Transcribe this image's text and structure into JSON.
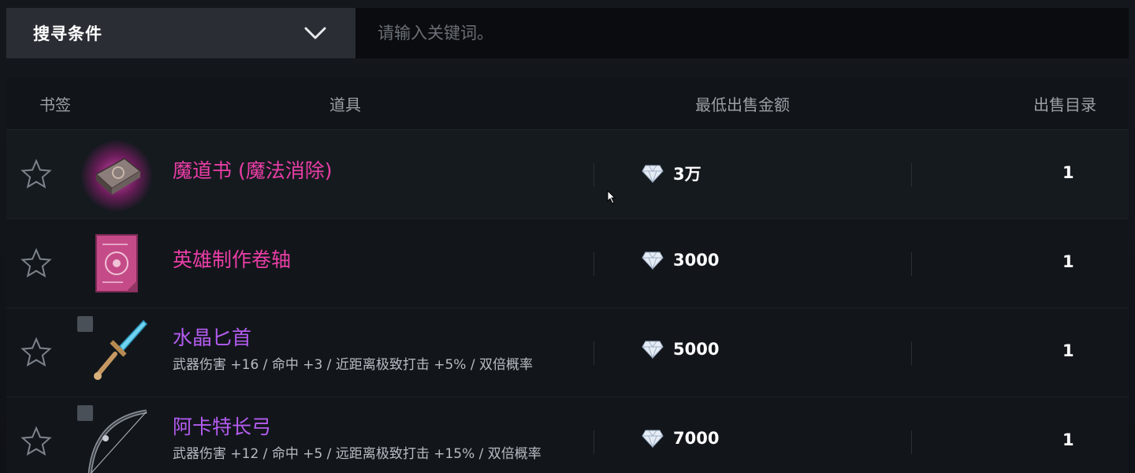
{
  "search": {
    "filter_label": "搜寻条件",
    "placeholder": "请输入关键词。"
  },
  "table": {
    "headers": {
      "bookmark": "书签",
      "item": "道具",
      "min_price": "最低出售金额",
      "listings": "出售目录"
    },
    "rows": [
      {
        "name": "魔道书 (魔法消除)",
        "stats": "",
        "price": "3万",
        "qty": "1",
        "name_color": "#ea3ea6",
        "icon": "spellbook-icon"
      },
      {
        "name": "英雄制作卷轴",
        "stats": "",
        "price": "3000",
        "qty": "1",
        "name_color": "#ea3ea6",
        "icon": "scroll-icon"
      },
      {
        "name": "水晶匕首",
        "stats": "武器伤害 +16 / 命中 +3 / 近距离极致打击 +5% / 双倍概率",
        "price": "5000",
        "qty": "1",
        "name_color": "#b45cf0",
        "icon": "dagger-icon"
      },
      {
        "name": "阿卡特长弓",
        "stats": "武器伤害 +12 / 命中 +5 / 远距离极致打击 +15% / 双倍概率",
        "price": "7000",
        "qty": "1",
        "name_color": "#b45cf0",
        "icon": "longbow-icon"
      }
    ]
  },
  "colors": {
    "rare_name": "#ea3ea6",
    "epic_name": "#b45cf0",
    "background": "#111418"
  }
}
